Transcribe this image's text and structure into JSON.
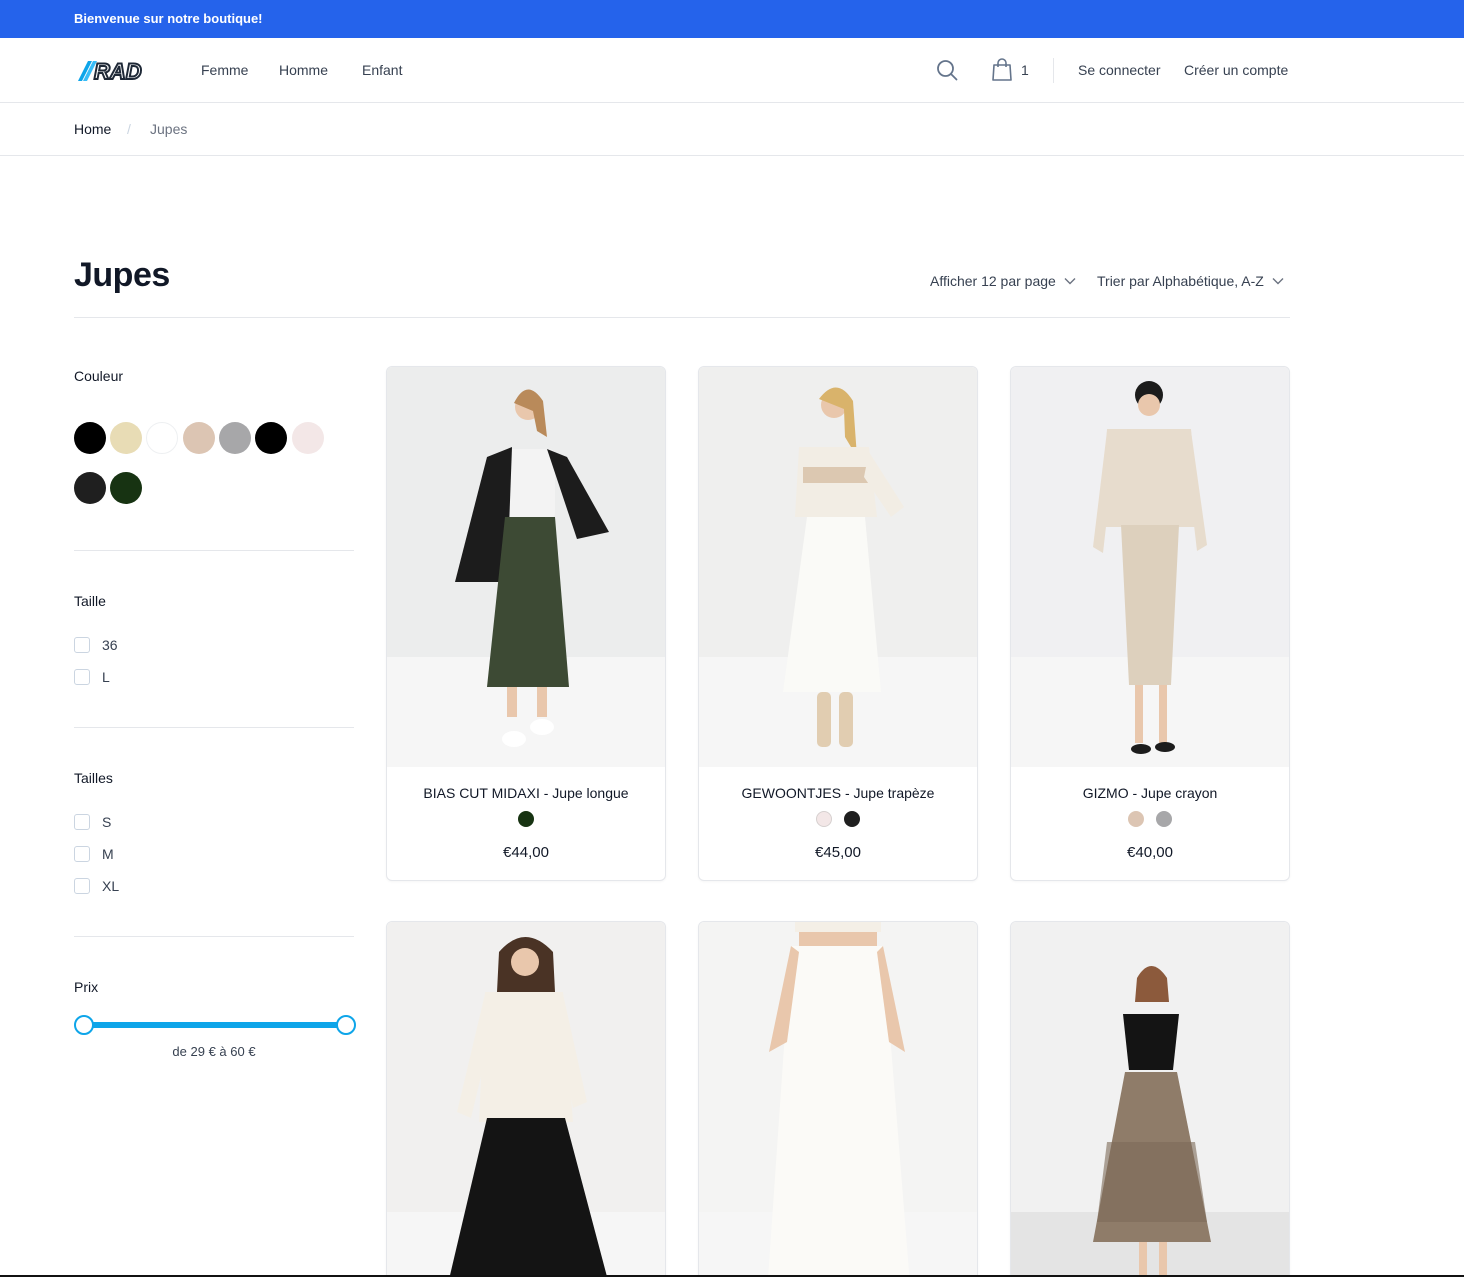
{
  "announcement": {
    "text": "Bienvenue sur notre boutique!",
    "color": "#2563eb"
  },
  "header": {
    "logo_text": "RAD",
    "nav": [
      {
        "label": "Femme"
      },
      {
        "label": "Homme"
      },
      {
        "label": "Enfant"
      }
    ],
    "icons": {
      "search": "search-icon",
      "cart": "shopping-bag-icon"
    },
    "cart_count": "1",
    "login_label": "Se connecter",
    "register_label": "Créer un compte"
  },
  "breadcrumb": {
    "home": "Home",
    "separator": "/",
    "current": "Jupes"
  },
  "page": {
    "title": "Jupes",
    "per_page_label": "Afficher 12 par page",
    "sort_label": "Trier par Alphabétique, A-Z"
  },
  "filters": {
    "color": {
      "title": "Couleur",
      "swatches": [
        "#000000",
        "#e8dcb5",
        "#ffffff",
        "#dcc5b3",
        "#a7a7a9",
        "#000000",
        "#f3e7e7",
        "#1f1f1f",
        "#173312"
      ]
    },
    "size": {
      "title": "Taille",
      "options": [
        "36",
        "L"
      ]
    },
    "sizes": {
      "title": "Tailles",
      "options": [
        "S",
        "M",
        "XL"
      ]
    },
    "price": {
      "title": "Prix",
      "label": "de 29 € à 60 €",
      "min": 29,
      "max": 60
    }
  },
  "products": [
    {
      "name": "BIAS CUT MIDAXI - Jupe longue",
      "price": "€44,00",
      "colors": [
        "#173312"
      ],
      "image": "woman-green-midi-skirt-black-blazer-photo"
    },
    {
      "name": "GEWOONTJES - Jupe trapèze",
      "price": "€45,00",
      "colors": [
        "#f3e7e7",
        "#1f1f1f"
      ],
      "image": "woman-white-a-line-skirt-striped-sweater-photo"
    },
    {
      "name": "GIZMO - Jupe crayon",
      "price": "€40,00",
      "colors": [
        "#dcc5b3",
        "#a7a7a9"
      ],
      "image": "woman-beige-pencil-skirt-cardigan-photo"
    },
    {
      "name": "",
      "price": "",
      "colors": [],
      "image": "woman-black-pleated-skirt-cream-sweater-photo"
    },
    {
      "name": "",
      "price": "",
      "colors": [],
      "image": "white-satin-midi-skirt-photo"
    },
    {
      "name": "",
      "price": "",
      "colors": [],
      "image": "woman-brown-tulle-skirt-black-top-photo"
    }
  ]
}
